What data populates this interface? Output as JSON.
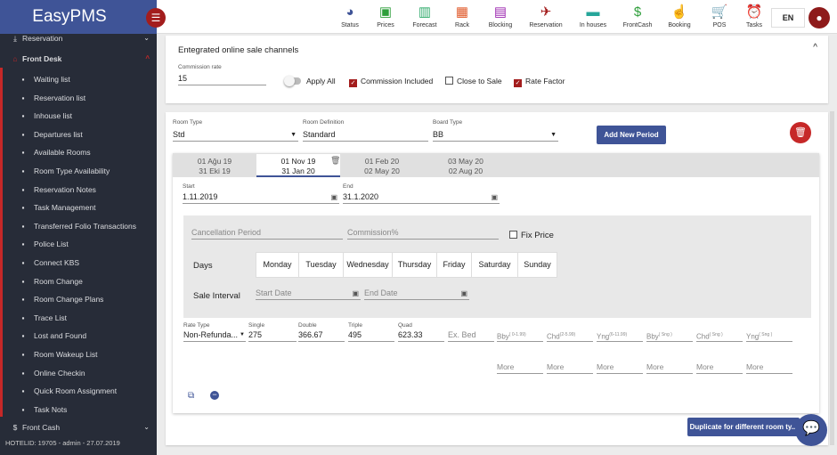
{
  "brand": "EasyPMS",
  "toolbar": [
    {
      "label": "Status",
      "icon": "pie-chart-icon",
      "color": "#3f5497",
      "glyph": "◕"
    },
    {
      "label": "Prices",
      "icon": "money-icon",
      "color": "#2e9e3a",
      "glyph": "▣"
    },
    {
      "label": "Forecast",
      "icon": "bar-chart-icon",
      "color": "#2eaa6a",
      "glyph": "▥"
    },
    {
      "label": "Rack",
      "icon": "grid-icon",
      "color": "#e0592a",
      "glyph": "▦"
    },
    {
      "label": "Blocking",
      "icon": "calendar-icon",
      "color": "#9c27b0",
      "glyph": "▤"
    },
    {
      "label": "Reservation",
      "icon": "flight-land-icon",
      "color": "#a31d1d",
      "glyph": "✈"
    },
    {
      "label": "In houses",
      "icon": "bed-icon",
      "color": "#26a69a",
      "glyph": "▬"
    },
    {
      "label": "FrontCash",
      "icon": "dollar-icon",
      "color": "#2e9e3a",
      "glyph": "$"
    },
    {
      "label": "Booking",
      "icon": "touch-icon",
      "color": "#ef7e4b",
      "glyph": "☝"
    },
    {
      "label": "POS",
      "icon": "cart-icon",
      "color": "#ef5a3a",
      "glyph": "🛒"
    },
    {
      "label": "Tasks",
      "icon": "alarm-icon",
      "color": "#e86a2a",
      "glyph": "⏰"
    }
  ],
  "lang": "EN",
  "sidebar": {
    "top": [
      {
        "label": "Reservation",
        "icon": "flight-land-icon"
      },
      {
        "label": "Front Desk",
        "icon": "home-icon"
      }
    ],
    "items": [
      {
        "label": "Waiting list",
        "icon": "clock-icon"
      },
      {
        "label": "Reservation list",
        "icon": "flight-land-icon"
      },
      {
        "label": "Inhouse list",
        "icon": "people-icon"
      },
      {
        "label": "Departures list",
        "icon": "flight-takeoff-icon"
      },
      {
        "label": "Available Rooms",
        "icon": "rooms-icon"
      },
      {
        "label": "Room Type Availability",
        "icon": "calendar-check-icon"
      },
      {
        "label": "Reservation Notes",
        "icon": "notes-icon"
      },
      {
        "label": "Task Management",
        "icon": "warning-icon"
      },
      {
        "label": "Transferred Folio Transactions",
        "icon": "table-icon"
      },
      {
        "label": "Police List",
        "icon": "grid-icon"
      },
      {
        "label": "Connect KBS",
        "icon": "shield-icon"
      },
      {
        "label": "Room Change",
        "icon": "swap-icon"
      },
      {
        "label": "Room Change Plans",
        "icon": "bell-icon"
      },
      {
        "label": "Trace List",
        "icon": "eye-icon"
      },
      {
        "label": "Lost and Found",
        "icon": "box-icon"
      },
      {
        "label": "Room Wakeup List",
        "icon": "alarm-icon"
      },
      {
        "label": "Online Checkin",
        "icon": "monitor-icon"
      },
      {
        "label": "Quick Room Assignment",
        "icon": "person-icon"
      },
      {
        "label": "Task Nots",
        "icon": "notes-icon"
      }
    ],
    "front_cash": "Front Cash",
    "footer": "HOTELID: 19705 - admin - 27.07.2019"
  },
  "channels": {
    "title": "Entegrated online sale channels",
    "commission_label": "Commission rate",
    "commission_value": "15",
    "apply_all": "Apply All",
    "commission_included": "Commission Included",
    "close_to_sale": "Close to Sale",
    "rate_factor": "Rate Factor",
    "commission_included_checked": true,
    "close_to_sale_checked": false,
    "rate_factor_checked": true
  },
  "period": {
    "room_type_label": "Room Type",
    "room_type": "Std",
    "room_def_label": "Room Definition",
    "room_def": "Standard",
    "board_label": "Board Type",
    "board": "BB",
    "add_period": "Add New Period",
    "tabs": [
      {
        "l1": "01 Ağu 19",
        "l2": "31 Eki 19"
      },
      {
        "l1": "01 Nov 19",
        "l2": "31 Jan 20"
      },
      {
        "l1": "01 Feb 20",
        "l2": "02 May 20"
      },
      {
        "l1": "03 May 20",
        "l2": "02 Aug 20"
      }
    ],
    "start_label": "Start",
    "start": "1.11.2019",
    "end_label": "End",
    "end": "31.1.2020",
    "cancel_ph": "Cancellation Period",
    "commission_ph": "Commission%",
    "fix_price": "Fix Price",
    "days_label": "Days",
    "days": [
      "Monday",
      "Tuesday",
      "Wednesday",
      "Thursday",
      "Friday",
      "Saturday",
      "Sunday"
    ],
    "sale_interval": "Sale Interval",
    "start_date_ph": "Start Date",
    "end_date_ph": "End Date",
    "rate_type_label": "Rate Type",
    "rate_type": "Non-Refunda...",
    "single_label": "Single",
    "single": "275",
    "double_label": "Double",
    "double": "366.67",
    "triple_label": "Triple",
    "triple": "495",
    "quad_label": "Quad",
    "quad": "623.33",
    "exbed_ph": "Ex. Bed",
    "extras": [
      {
        "n": "Bby",
        "s": "( 0-1.99)"
      },
      {
        "n": "Chd",
        "s": "(2-5.99)"
      },
      {
        "n": "Yng",
        "s": "(6-11.99)"
      },
      {
        "n": "Bby",
        "s": "( Sng )"
      },
      {
        "n": "Chd",
        "s": "( Sng )"
      },
      {
        "n": "Yng",
        "s": "( Sng )"
      }
    ],
    "more": "More",
    "duplicate": "Duplicate for different room ty..."
  }
}
